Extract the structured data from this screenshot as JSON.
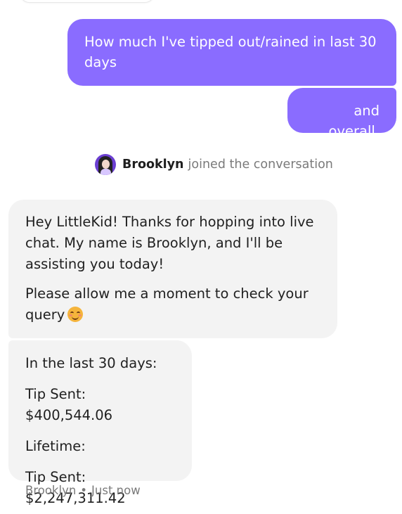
{
  "messages_out": [
    {
      "text": "How much I've tipped out/rained in last 30 days"
    },
    {
      "text": "and overall."
    }
  ],
  "join_notice": {
    "name": "Brooklyn",
    "text": "joined the conversation"
  },
  "messages_in": {
    "greeting": {
      "para1": "Hey LittleKid! Thanks for hopping into live chat. My name is Brooklyn, and I'll be assisting you today!",
      "para2": "Please allow me a moment to check your query"
    },
    "stats": {
      "line1": "In the last 30 days:",
      "line2": "Tip Sent: $400,544.06",
      "line3": "Lifetime:",
      "line4": "Tip Sent: $2,247,311.42"
    }
  },
  "meta": {
    "sender": "Brooklyn",
    "separator": "•",
    "time": "Just now"
  },
  "colors": {
    "outgoing_bubble": "#8a6cff",
    "incoming_bubble": "#f3f3f3",
    "muted_text": "#7a7a7a"
  },
  "icons": {
    "avatar": "agent-avatar",
    "emoji": "smiling-face-emoji"
  }
}
